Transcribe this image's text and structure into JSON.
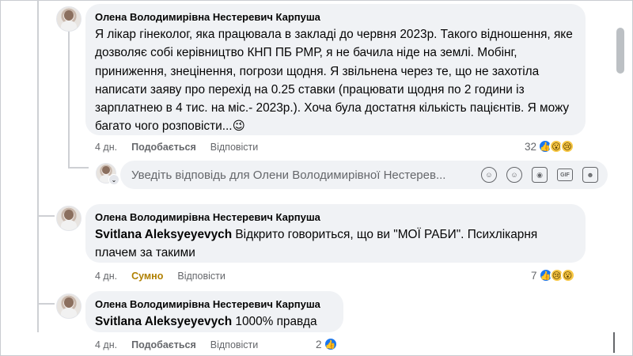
{
  "comments": [
    {
      "author": "Олена Володимирівна Нестеревич Карпуша",
      "text": "Я лікар гінеколог, яка працювала в закладі до червня 2023р. Такого відношення, яке дозволяє собі керівництво КНП ПБ РМР, я не бачила ніде на землі. Мобінг, приниження, знецінення, погрози щодня. Я звільнена через те, що не захотіла написати заяву про перехід на 0.25 ставки (працювати щодня по 2 години із зарплатнею в 4 тис. на міс.- 2023р.). Хоча була достатня кількість пацієнтів. Я можу багато чого розповісти...",
      "emoji": "😉",
      "time": "4 дн.",
      "reaction_action": "Подобається",
      "reply_label": "Відповісти",
      "reaction_count": "32",
      "reaction_icons": [
        "like-icon",
        "wow-icon",
        "sad-icon"
      ]
    },
    {
      "author": "Олена Володимирівна Нестеревич Карпуша",
      "mention": "Svitlana Aleksyeyevych",
      "text": " Відкрито говориться, що ви \"МОЇ РАБИ\". Психлікарня плачем за такими",
      "time": "4 дн.",
      "reaction_action": "Сумно",
      "reply_label": "Відповісти",
      "reaction_count": "7",
      "reaction_icons": [
        "like-icon",
        "sad-icon",
        "wow-icon"
      ]
    },
    {
      "author": "Олена Володимирівна Нестеревич Карпуша",
      "mention": "Svitlana Aleksyeyevych",
      "text": " 1000% правда",
      "time": "4 дн.",
      "reaction_action": "Подобається",
      "reply_label": "Відповісти",
      "reaction_count": "2",
      "reaction_icons": [
        "like-icon"
      ]
    }
  ],
  "reply_box": {
    "placeholder": "Уведіть відповідь для Олени Володимирівної Нестерев...",
    "tools": [
      "sticker-avatar-icon",
      "emoji-icon",
      "camera-icon",
      "gif-icon",
      "sticker-icon"
    ],
    "gif_label": "GIF"
  },
  "colors": {
    "bubble": "#f0f2f5",
    "like_blue": "#1877f2",
    "sad_reaction_text": "#b08000",
    "meta_gray": "#65676b"
  }
}
